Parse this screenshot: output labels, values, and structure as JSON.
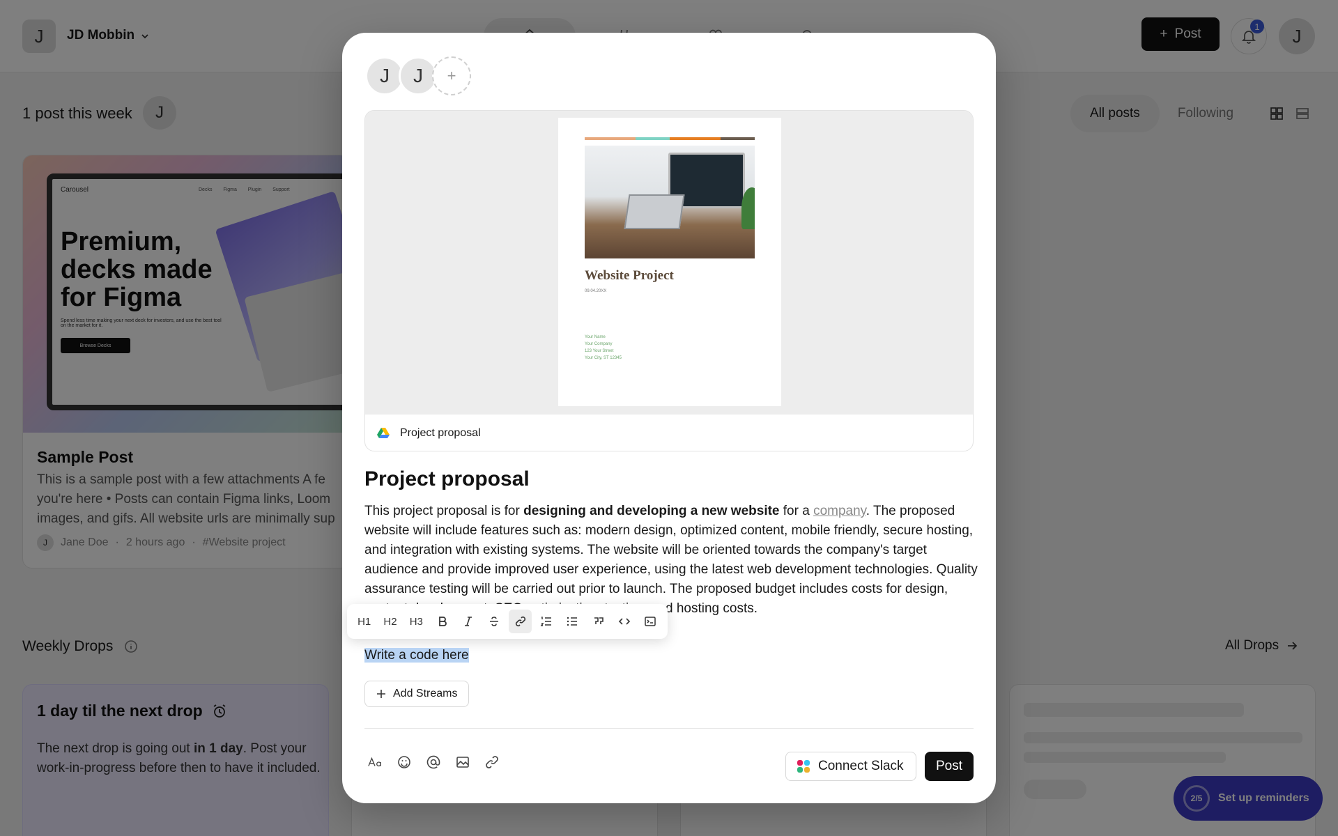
{
  "workspace": {
    "avatar_letter": "J",
    "name": "JD Mobbin"
  },
  "header": {
    "post_button": "Post",
    "notification_count": "1",
    "user_avatar_letter": "J"
  },
  "feed": {
    "week_label": "1 post this week",
    "week_avatar_letter": "J",
    "filters": {
      "all": "All posts",
      "following": "Following"
    }
  },
  "sample_post": {
    "thumb": {
      "logo": "Carousel",
      "nav": "Decks Figma Plugin Support",
      "headline": "Premium, decks made for Figma",
      "subtext": "Spend less time making your next deck for investors, and use the best tool on the market for it.",
      "button": "Browse Decks"
    },
    "title": "Sample Post",
    "body": "This is a sample post with a few attachments A fe you're here • Posts can contain Figma links, Loom images, and gifs. All website urls are minimally sup",
    "author_letter": "J",
    "author": "Jane Doe",
    "time": "2 hours ago",
    "tag": "#Website project"
  },
  "drops": {
    "label": "Weekly Drops",
    "all_link": "All Drops",
    "card_title": "1 day til the next drop",
    "card_body_pre": "The next drop is going out ",
    "card_body_bold": "in 1 day",
    "card_body_post": ". Post your work-in-progress before then to have it included."
  },
  "reminder": {
    "progress": "2/5",
    "label": "Set up reminders"
  },
  "modal": {
    "avatars": [
      "J",
      "J"
    ],
    "add_symbol": "+",
    "attachment": {
      "doc_title": "Website Project",
      "doc_date": "09.04.20XX",
      "doc_contact": [
        "Your Name",
        "Your Company",
        "123 Your Street",
        "Your City, ST 12345"
      ],
      "caption": "Project proposal"
    },
    "heading": "Project proposal",
    "paragraph": {
      "p1": "This project proposal is for ",
      "bold": "designing and developing a new website",
      "p2": " for a ",
      "link": "company",
      "p3": ". The proposed website will include features such as: modern design, optimized content, mobile friendly, secure hosting, and integration with existing systems. The website will be oriented towards the company's target audience and provide improved user experience, using the latest web development technologies. Quality assurance testing will be carried out prior to launch. The proposed budget includes costs for design, content development, SEO ",
      "misspelled": "optimization",
      "p4": ", testing, and hosting costs."
    },
    "toolbar": [
      "H1",
      "H2",
      "H3",
      "bold",
      "italic",
      "strikethrough",
      "link",
      "ordered-list",
      "bullet-list",
      "quote",
      "code",
      "code-block"
    ],
    "code_text": "Write a code here",
    "add_streams": "Add Streams",
    "connect_slack": "Connect Slack",
    "post_button": "Post"
  },
  "colors": {
    "accent": "#3c3ac4",
    "selection": "#b9d4f4",
    "badge": "#3b5bdb"
  }
}
